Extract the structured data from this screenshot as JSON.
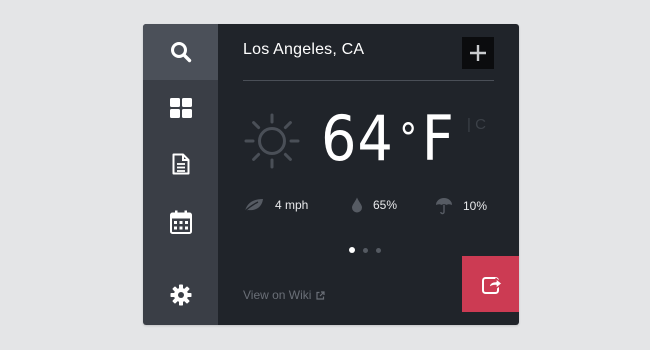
{
  "sidebar": {
    "items": [
      {
        "icon": "search-icon",
        "active": true
      },
      {
        "icon": "grid-icon",
        "active": false
      },
      {
        "icon": "document-icon",
        "active": false
      },
      {
        "icon": "calendar-icon",
        "active": false
      },
      {
        "icon": "gear-icon",
        "active": false
      }
    ]
  },
  "weather": {
    "location": "Los Angeles, CA",
    "temperature": "64",
    "degree_symbol": "°",
    "unit": "F",
    "alt_unit": "| C",
    "condition_icon": "sun-icon",
    "stats": {
      "wind": {
        "icon": "leaf-icon",
        "value": "4 mph"
      },
      "humidity": {
        "icon": "drop-icon",
        "value": "65%"
      },
      "precipitation": {
        "icon": "umbrella-icon",
        "value": "10%"
      }
    },
    "pagination": {
      "count": 3,
      "active": 1
    }
  },
  "footer": {
    "wiki_link": "View on Wiki",
    "share_icon": "share-icon",
    "add_icon": "plus-icon"
  },
  "colors": {
    "page_bg": "#e4e5e7",
    "sidebar_bg": "#3a3e46",
    "sidebar_active_bg": "#4b5059",
    "panel_bg": "#20242a",
    "accent": "#cc3b53"
  }
}
